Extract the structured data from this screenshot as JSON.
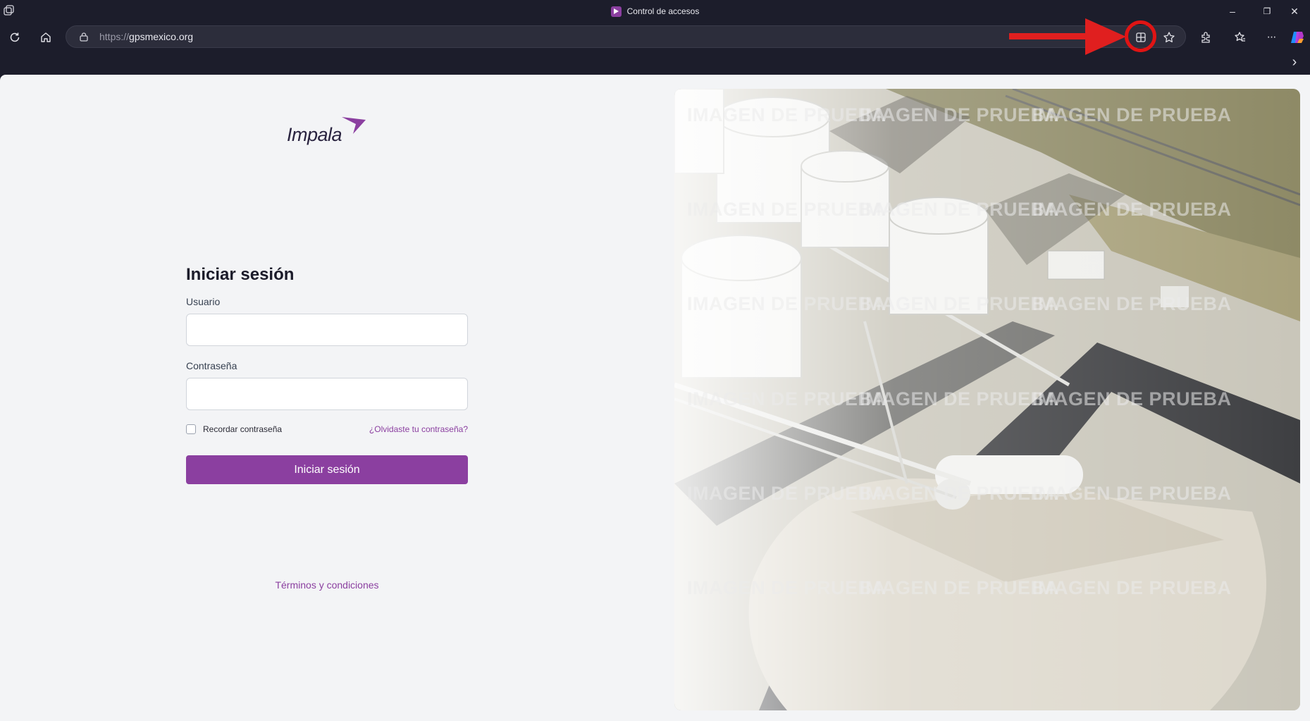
{
  "browser": {
    "tab_title": "Control de accesos",
    "url_protocol": "https://",
    "url_host": "gpsmexico.org",
    "window_controls": {
      "minimize": "–",
      "restore": "❐",
      "close": "✕"
    },
    "more_label": "···",
    "sidebar_toggle": "›"
  },
  "login": {
    "logo_text": "Impala",
    "title": "Iniciar sesión",
    "username_label": "Usuario",
    "username_value": "",
    "password_label": "Contraseña",
    "password_value": "",
    "remember_label": "Recordar contraseña",
    "remember_checked": false,
    "forgot_link": "¿Olvidaste tu contraseña?",
    "submit_label": "Iniciar sesión",
    "terms_link": "Términos y condiciones"
  },
  "hero": {
    "watermark": "IMAGEN DE PRUEBA"
  },
  "colors": {
    "brand": "#8b3fa0",
    "chrome_bg": "#1c1d2b",
    "annotation": "#e01f1f"
  }
}
